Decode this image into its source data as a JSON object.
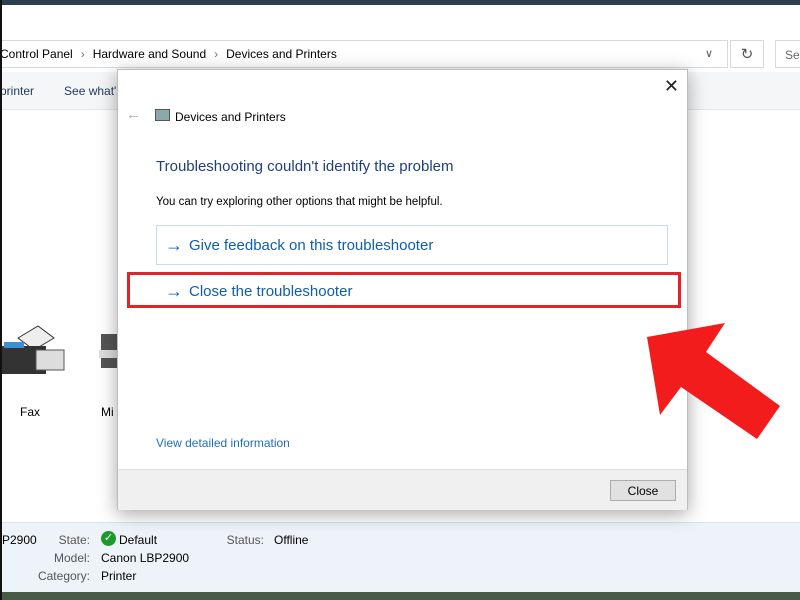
{
  "explorer": {
    "breadcrumb": [
      "Control Panel",
      "Hardware and Sound",
      "Devices and Printers"
    ],
    "search_placeholder": "Se",
    "toolbar": [
      "printer",
      "See what's"
    ],
    "devices": [
      {
        "label": "Fax"
      },
      {
        "label": "Mi"
      }
    ],
    "details": {
      "name": "P2900",
      "state_label": "State:",
      "state": "Default",
      "model_label": "Model:",
      "model": "Canon LBP2900",
      "category_label": "Category:",
      "category": "Printer",
      "status_label": "Status:",
      "status": "Offline"
    }
  },
  "dialog": {
    "title": "Devices and Printers",
    "heading": "Troubleshooting couldn't identify the problem",
    "message": "You can try exploring other options that might be helpful.",
    "options": [
      {
        "label": "Give feedback on this troubleshooter"
      },
      {
        "label": "Close the troubleshooter"
      }
    ],
    "detail_link": "View detailed information",
    "close_button": "Close"
  },
  "annotation": {
    "highlight_color": "#e8202a",
    "arrow_color": "#f21c1c"
  }
}
